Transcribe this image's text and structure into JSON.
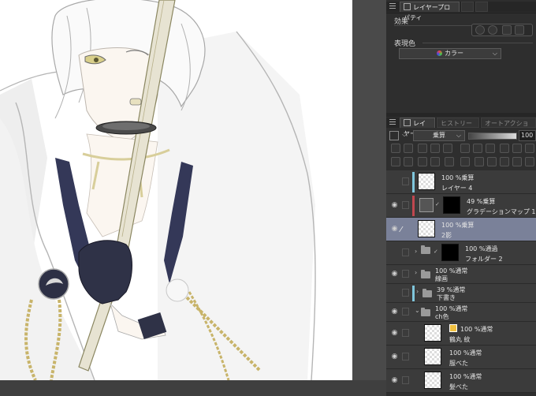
{
  "props_panel": {
    "tab_label": "レイヤープロパティ",
    "effect_label": "効果",
    "expression_label": "表現色",
    "expression_value": "カラー"
  },
  "layer_panel": {
    "tab_layer": "レイヤー",
    "tab_history": "ヒストリー",
    "tab_auto_action": "オートアクション",
    "blend_mode": "乗算",
    "opacity_value": "100"
  },
  "layers": [
    {
      "mode": "100 %乗算",
      "name": "レイヤー 4"
    },
    {
      "mode": "49 %乗算",
      "name": "グラデーションマップ 1"
    },
    {
      "mode": "100 %乗算",
      "name": "2影"
    },
    {
      "mode": "100 %通過",
      "name": "フォルダー 2"
    },
    {
      "mode": "100 %通常",
      "name": "線画"
    },
    {
      "mode": "39 %通常",
      "name": "下書き"
    },
    {
      "mode": "100 %通常",
      "name": "ch色"
    },
    {
      "mode": "100 %通常",
      "name": "鶴丸 紋"
    },
    {
      "mode": "100 %通常",
      "name": "服べた"
    },
    {
      "mode": "100 %通常",
      "name": "髪べた"
    }
  ],
  "colors": {
    "panel_bg": "#2e2e2e",
    "selected_row": "#7a8199",
    "accent_cyan": "#7fc6dc",
    "accent_red": "#c0474f"
  }
}
